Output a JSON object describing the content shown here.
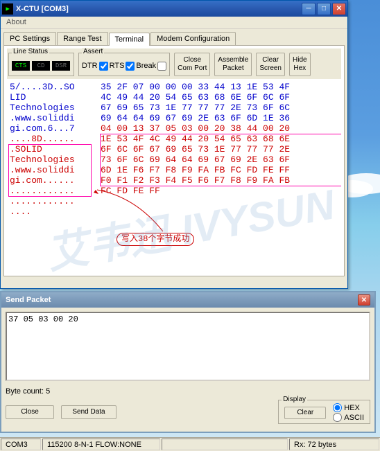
{
  "window": {
    "title": "X-CTU   [COM3]",
    "menu_about": "About"
  },
  "tabs": {
    "t1": "PC Settings",
    "t2": "Range Test",
    "t3": "Terminal",
    "t4": "Modem Configuration"
  },
  "line_status": {
    "label": "Line Status",
    "cts": "CTS",
    "cd": "CD",
    "dsr": "DSR"
  },
  "assert": {
    "label": "Assert",
    "dtr": "DTR",
    "rts": "RTS",
    "break": "Break"
  },
  "buttons": {
    "close_com": "Close\nCom Port",
    "assemble": "Assemble\nPacket",
    "clear_scr": "Clear\nScreen",
    "hide_hex": "Hide\nHex"
  },
  "ascii_lines": [
    {
      "t": "5/....3D..SO",
      "c": "b"
    },
    {
      "t": "LID ",
      "c": "b"
    },
    {
      "t": "Technologies",
      "c": "b"
    },
    {
      "t": ".www.soliddi",
      "c": "b"
    },
    {
      "t": "gi.com.6...7",
      "c": "b"
    },
    {
      "t": "....8D......",
      "c": "r"
    },
    {
      "t": ".SOLID ",
      "c": "r"
    },
    {
      "t": "Technologies",
      "c": "r"
    },
    {
      "t": ".www.soliddi",
      "c": "r"
    },
    {
      "t": "gi.com......",
      "c": "r"
    },
    {
      "t": "............",
      "c": "r"
    },
    {
      "t": "............",
      "c": "r"
    },
    {
      "t": "....",
      "c": "r"
    }
  ],
  "hex_lines": [
    {
      "t": "35 2F 07 00 00 00 33 44 13 1E 53 4F",
      "c": "b"
    },
    {
      "t": "4C 49 44 20 54 65 63 68 6E 6F 6C 6F",
      "c": "b"
    },
    {
      "t": "67 69 65 73 1E 77 77 77 2E 73 6F 6C",
      "c": "b"
    },
    {
      "t": "69 64 64 69 67 69 2E 63 6F 6D 1E 36",
      "c": "b"
    },
    {
      "t": "04 00 13 37 05 03 00 20 38 44 00 20",
      "c": "r"
    },
    {
      "t": "1E 53 4F 4C 49 44 20 54 65 63 68 6E",
      "c": "r"
    },
    {
      "t": "6F 6C 6F 67 69 65 73 1E 77 77 77 2E",
      "c": "r"
    },
    {
      "t": "73 6F 6C 69 64 64 69 67 69 2E 63 6F",
      "c": "r"
    },
    {
      "t": "6D 1E F6 F7 F8 F9 FA FB FC FD FE FF",
      "c": "r"
    },
    {
      "t": "F0 F1 F2 F3 F4 F5 F6 F7 F8 F9 FA FB",
      "c": "r"
    },
    {
      "t": "FC FD FE FF",
      "c": "r"
    }
  ],
  "annotation": "写入38个字节成功",
  "send": {
    "title": "Send Packet",
    "value": "37 05 03 00 20",
    "byte_count_label": "Byte count:  5",
    "close": "Close",
    "send_data": "Send Data",
    "display": "Display",
    "clear": "Clear",
    "hex": "HEX",
    "ascii": "ASCII"
  },
  "status": {
    "port": "COM3",
    "settings": "115200 8-N-1  FLOW:NONE",
    "rx": "Rx: 72 bytes"
  }
}
